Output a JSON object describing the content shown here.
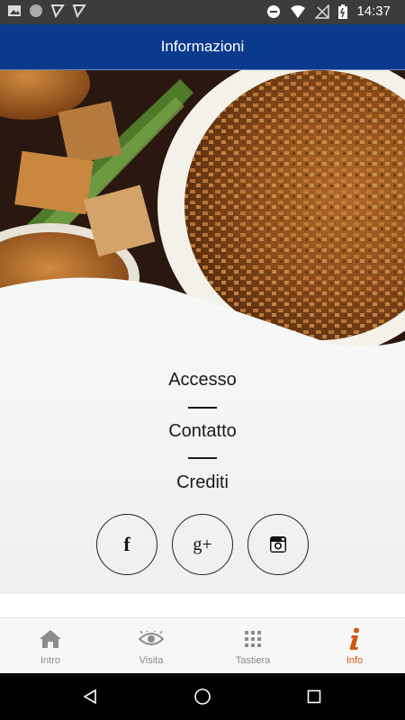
{
  "status_bar": {
    "time": "14:37",
    "left_icons": [
      "image-icon",
      "circle-icon",
      "check-pen-icon",
      "check-pen-icon"
    ],
    "right_icons": [
      "dnd-icon",
      "wifi-icon",
      "signal-icon",
      "battery-icon"
    ]
  },
  "app_bar": {
    "title": "Informazioni",
    "color": "#0a3a8c"
  },
  "menu": {
    "items": [
      {
        "label": "Accesso"
      },
      {
        "label": "Contatto"
      },
      {
        "label": "Crediti"
      }
    ]
  },
  "social": {
    "items": [
      {
        "name": "facebook-icon",
        "glyph": "f"
      },
      {
        "name": "google-plus-icon",
        "glyph": "g+"
      },
      {
        "name": "instagram-icon",
        "glyph": ""
      }
    ]
  },
  "bottom_nav": {
    "active_color": "#d35a12",
    "items": [
      {
        "label": "Intro",
        "icon": "home-icon"
      },
      {
        "label": "Visita",
        "icon": "eye-icon"
      },
      {
        "label": "Tastiera",
        "icon": "keypad-icon"
      },
      {
        "label": "Info",
        "icon": "info-icon"
      }
    ]
  },
  "system_nav": {
    "icons": [
      "back-icon",
      "home-circle-icon",
      "recents-icon"
    ]
  }
}
